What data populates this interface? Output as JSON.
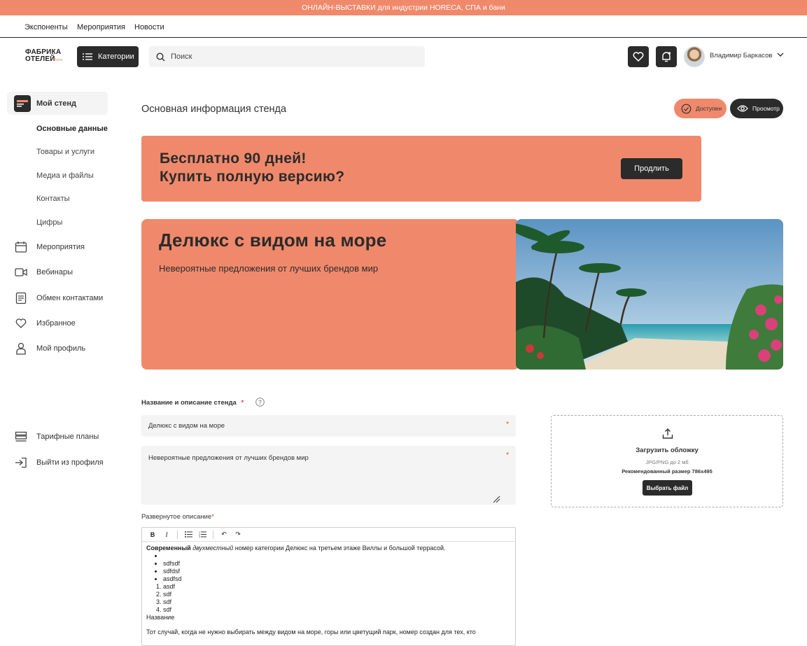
{
  "promo_bar": "ОНЛАЙН-ВЫСТАВКИ для индустрии HORECA, СПА и бани",
  "topnav": [
    "Экспоненты",
    "Мероприятия",
    "Новости"
  ],
  "header": {
    "logo_line1": "ФАБРИКА",
    "logo_line2": "ОТЕЛЕЙ",
    "logo_beta": "beta",
    "categories_label": "Категории",
    "search_placeholder": "Поиск",
    "username": "Владимир Баркасов"
  },
  "sidebar": {
    "my_stand": "Мой стенд",
    "sub_items": [
      "Основные данные",
      "Товары и услуги",
      "Медиа и файлы",
      "Контакты",
      "Цифры"
    ],
    "items": [
      "Мероприятия",
      "Вебинары",
      "Обмен контактами",
      "Избранное",
      "Мой профиль"
    ],
    "bottom_items": [
      "Тарифные планы",
      "Выйти из профиля"
    ]
  },
  "main": {
    "title": "Основная информация стенда",
    "status_label": "Доступен",
    "preview_label": "Просмотр",
    "banner_line1": "Бесплатно 90 дней!",
    "banner_line2": "Купить полную версию?",
    "banner_button": "Продлить",
    "hero_title": "Делюкс с видом на море",
    "hero_subtitle": "Невероятные предложения от лучших брендов мир"
  },
  "form": {
    "section_label": "Название и описание стенда",
    "required_mark": "*",
    "name_value": "Делюкс с видом на море",
    "desc_value": "Невероятные предложения от лучших брендов мир",
    "upload_title": "Загрузить обложку",
    "upload_formats": "JPG/PNG до 2 мб",
    "upload_size": "Рекомендованный размер 786х495",
    "upload_button": "Выбрать файл",
    "editor_label": "Развернутое описание",
    "editor_toolbar": [
      "B",
      "I",
      "•≡",
      "1≡",
      "↶",
      "↷"
    ],
    "editor_line1_bold": "Современный",
    "editor_line1_italic": "двухместный",
    "editor_line1_rest": " номер категории Делюкс на третьем этаже Виллы и большой террасой.",
    "editor_bullets": [
      "",
      "sdfsdf",
      "sdfdsf",
      "asdfsd"
    ],
    "editor_numbers": [
      "asdf",
      "sdf",
      "sdf",
      "sdf"
    ],
    "editor_heading": "Название",
    "editor_tail": "Тот случай, когда не нужно выбирать между видом на море, горы или цветущий парк, номер создан для тех, кто"
  }
}
